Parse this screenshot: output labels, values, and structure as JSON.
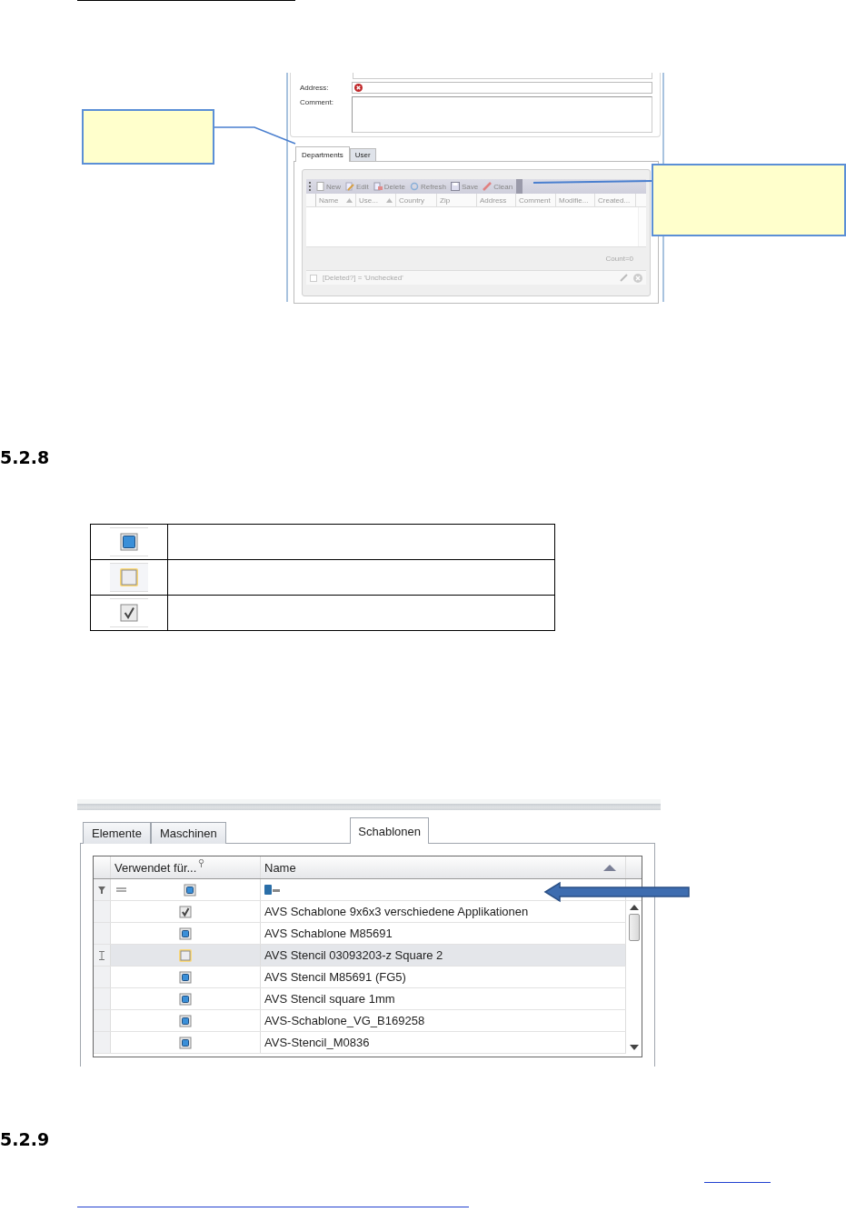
{
  "form_window": {
    "fields": [
      {
        "label": "Address:",
        "error": true,
        "multiline": false
      },
      {
        "label": "Comment:",
        "error": false,
        "multiline": true
      }
    ],
    "tabs": [
      {
        "label": "Departments",
        "selected": true
      },
      {
        "label": "User",
        "selected": false
      }
    ],
    "toolbar": [
      {
        "label": "New",
        "kind": "new"
      },
      {
        "label": "Edit",
        "kind": "edit"
      },
      {
        "label": "Delete",
        "kind": "delete"
      },
      {
        "label": "Refresh",
        "kind": "refresh"
      },
      {
        "label": "Save",
        "kind": "save"
      },
      {
        "label": "Clean",
        "kind": "clean"
      }
    ],
    "columns": [
      {
        "label": "Name",
        "sorted": true
      },
      {
        "label": "Use...",
        "sorted": true
      },
      {
        "label": "Country",
        "sorted": false
      },
      {
        "label": "Zip",
        "sorted": false
      },
      {
        "label": "Address",
        "sorted": false
      },
      {
        "label": "Comment",
        "sorted": false
      },
      {
        "label": "Modifie...",
        "sorted": false
      },
      {
        "label": "Created...",
        "sorted": false
      }
    ],
    "count": "Count=0",
    "filter": "[Deleted?] = 'Unchecked'"
  },
  "headings": [
    "5.2.8",
    "5.2.9"
  ],
  "legend": [
    {
      "checked": false,
      "indeterminate": true,
      "focused": false
    },
    {
      "checked": false,
      "indeterminate": false,
      "focused": true
    },
    {
      "checked": true,
      "indeterminate": false,
      "focused": false
    }
  ],
  "grid_window": {
    "tabs": [
      {
        "label": "Elemente",
        "selected": false
      },
      {
        "label": "Maschinen",
        "selected": false
      },
      {
        "label": "Schablonen",
        "selected": true
      }
    ],
    "columns": [
      {
        "label": "Verwendet für...",
        "sorted": false
      },
      {
        "label": "Name",
        "sorted": true
      }
    ],
    "filter_checkbox": {
      "checked": false,
      "indeterminate": true,
      "focused": false
    },
    "rows": [
      {
        "checked": true,
        "indeterminate": false,
        "focused": false,
        "name": "AVS Schablone 9x6x3 verschiedene Applikationen",
        "selected": false
      },
      {
        "checked": false,
        "indeterminate": true,
        "focused": false,
        "name": "AVS Schablone M85691",
        "selected": false
      },
      {
        "checked": false,
        "indeterminate": false,
        "focused": true,
        "name": "AVS Stencil 03093203-z Square 2",
        "selected": true
      },
      {
        "checked": false,
        "indeterminate": true,
        "focused": false,
        "name": "AVS Stencil M85691 (FG5)",
        "selected": false
      },
      {
        "checked": false,
        "indeterminate": true,
        "focused": false,
        "name": "AVS Stencil square 1mm",
        "selected": false
      },
      {
        "checked": false,
        "indeterminate": true,
        "focused": false,
        "name": "AVS-Schablone_VG_B169258",
        "selected": false
      },
      {
        "checked": false,
        "indeterminate": true,
        "focused": false,
        "name": "AVS-Stencil_M0836",
        "selected": false
      }
    ]
  }
}
